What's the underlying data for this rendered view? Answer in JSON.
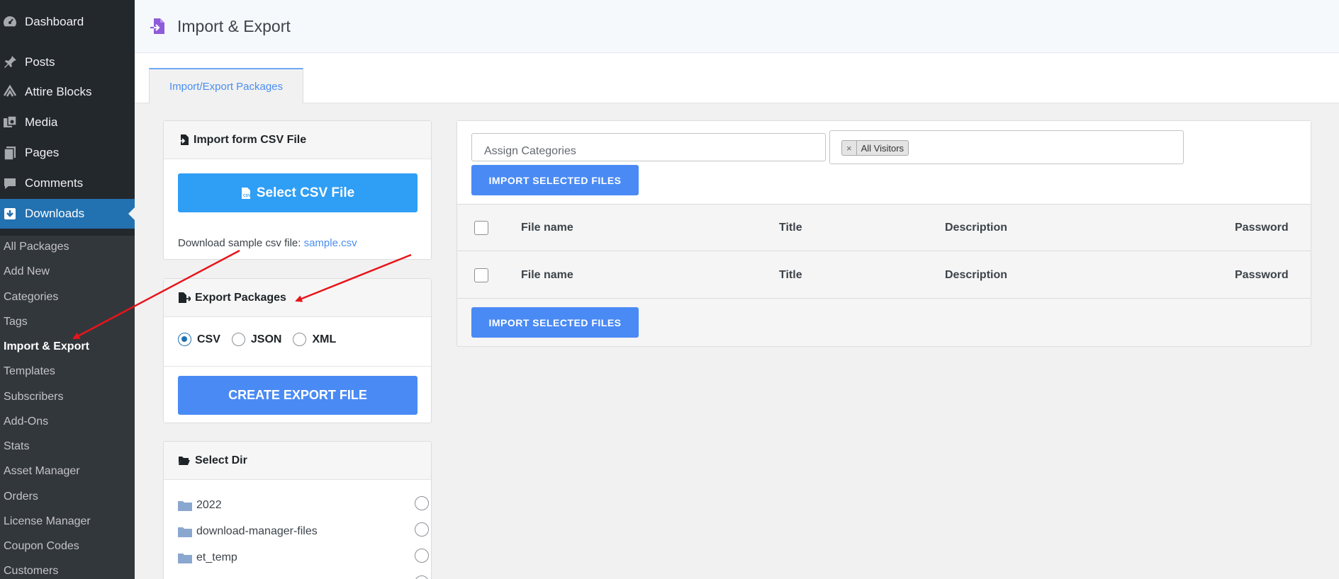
{
  "sidebar": {
    "items": [
      {
        "label": "Dashboard",
        "icon": "dashboard-icon"
      },
      {
        "label": "Posts",
        "icon": "pin-icon"
      },
      {
        "label": "Attire Blocks",
        "icon": "blocks-icon"
      },
      {
        "label": "Media",
        "icon": "media-icon"
      },
      {
        "label": "Pages",
        "icon": "pages-icon"
      },
      {
        "label": "Comments",
        "icon": "comments-icon"
      },
      {
        "label": "Downloads",
        "icon": "download-icon"
      }
    ],
    "submenu": [
      "All Packages",
      "Add New",
      "Categories",
      "Tags",
      "Import & Export",
      "Templates",
      "Subscribers",
      "Add-Ons",
      "Stats",
      "Asset Manager",
      "Orders",
      "License Manager",
      "Coupon Codes",
      "Customers"
    ]
  },
  "header": {
    "title": "Import & Export",
    "icon": "import-export-icon"
  },
  "tabs": [
    {
      "label": "Import/Export Packages"
    }
  ],
  "import_csv": {
    "title": "Import form CSV File",
    "button": "Select CSV File",
    "sample_text": "Download sample csv file: ",
    "sample_link": "sample.csv"
  },
  "export": {
    "title": "Export Packages",
    "formats": [
      "CSV",
      "JSON",
      "XML"
    ],
    "selected": "CSV",
    "button": "CREATE EXPORT FILE"
  },
  "select_dir": {
    "title": "Select Dir",
    "dirs": [
      "2022",
      "download-manager-files",
      "et_temp"
    ]
  },
  "import_panel": {
    "categories_placeholder": "Assign Categories",
    "access_tag": "All Visitors",
    "tag_remove": "×",
    "import_button": "IMPORT SELECTED FILES",
    "columns": [
      "File name",
      "Title",
      "Description",
      "Password"
    ]
  },
  "colors": {
    "sidebar_bg": "#23282d",
    "active_menu": "#2271b1",
    "primary_button": "#2f9ef5",
    "import_button": "#4a8af4",
    "link": "#4a8ef0",
    "annotation_arrow": "#e8141a"
  }
}
